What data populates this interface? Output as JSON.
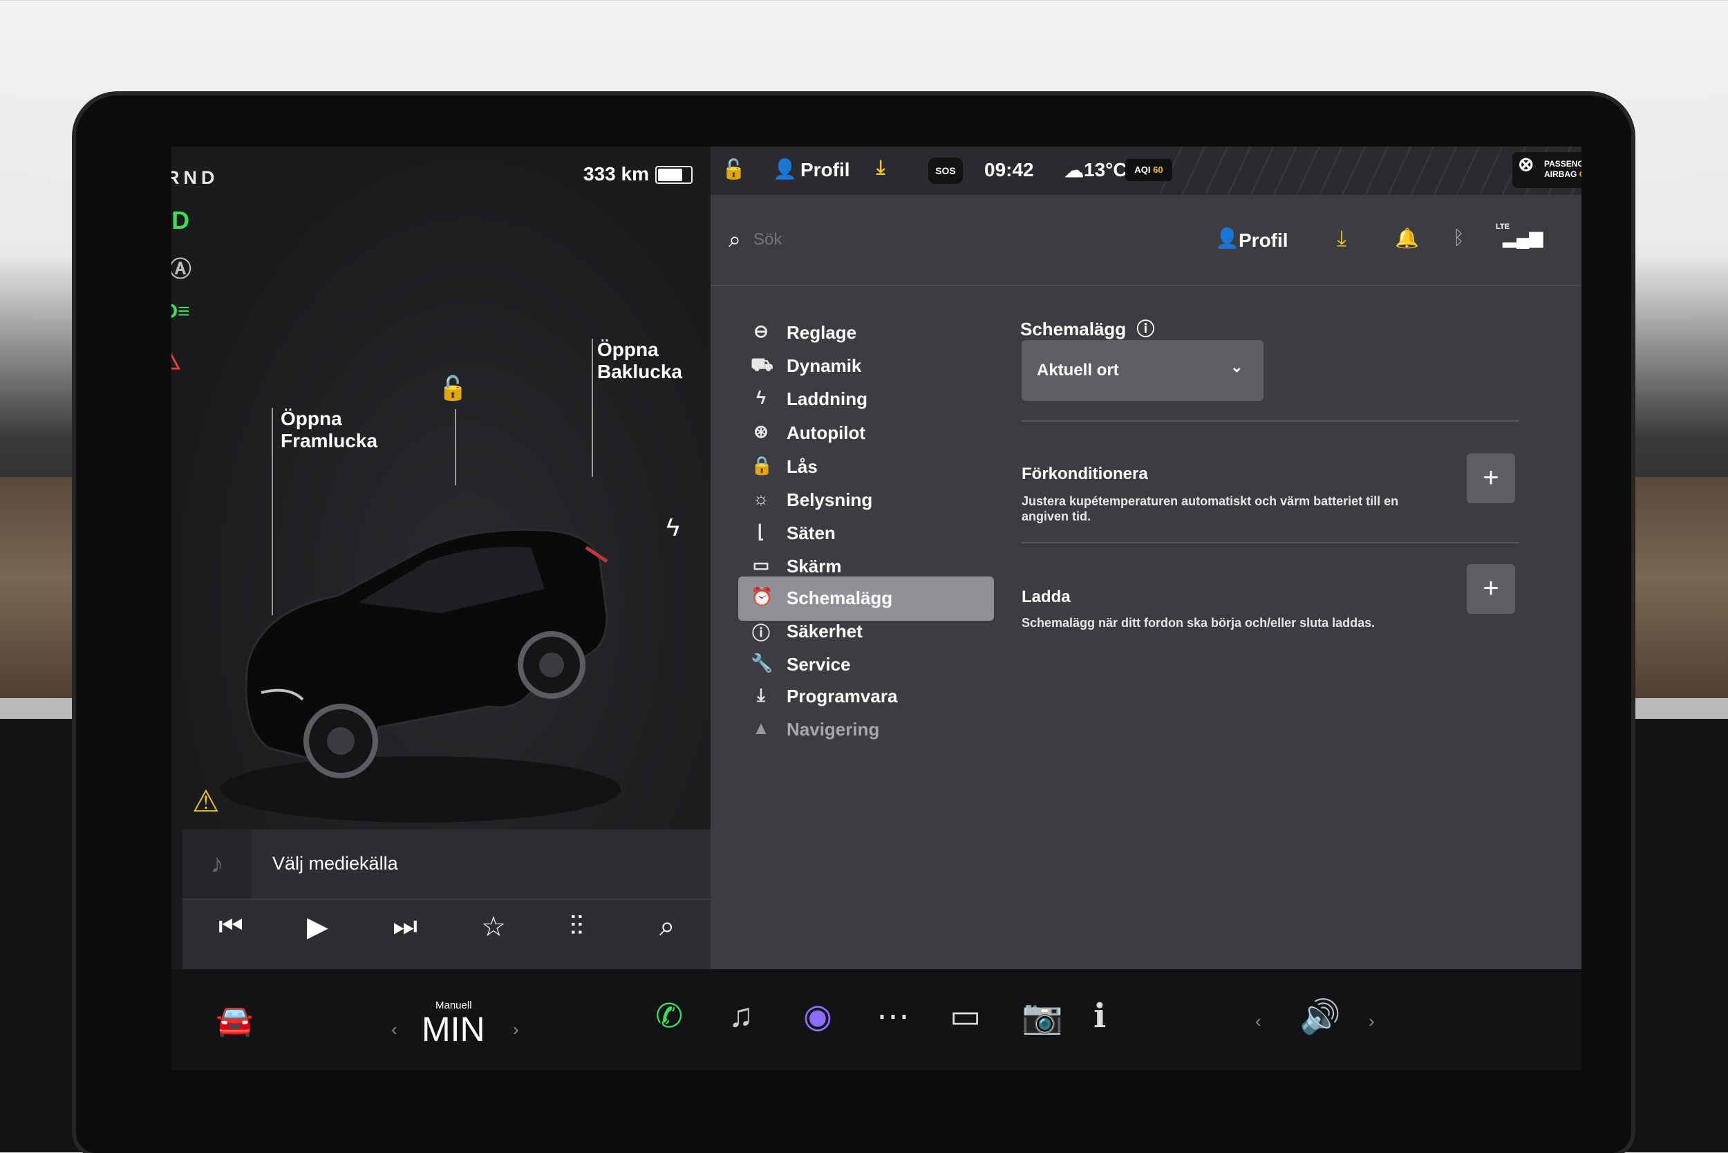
{
  "status": {
    "gear": "PRND",
    "range": "333 km",
    "battery_level": 0.7,
    "time": "09:42",
    "temperature": "13°C",
    "aqi_label": "AQI",
    "aqi_value": "60",
    "profile": "Profil",
    "sos": "SOS",
    "airbag_line1": "PASSENGER",
    "airbag_line2": "AIRBAG",
    "airbag_state": "ON",
    "lte": "LTE"
  },
  "car": {
    "frunk_label_1": "Öppna",
    "frunk_label_2": "Framlucka",
    "trunk_label_1": "Öppna",
    "trunk_label_2": "Baklucka"
  },
  "media": {
    "source_label": "Välj mediekälla"
  },
  "dock": {
    "climate_label": "Manuell",
    "climate_value": "MIN"
  },
  "search": {
    "placeholder": "Sök",
    "profile_label": "Profil"
  },
  "nav": {
    "items": [
      {
        "label": "Reglage"
      },
      {
        "label": "Dynamik"
      },
      {
        "label": "Laddning"
      },
      {
        "label": "Autopilot"
      },
      {
        "label": "Lås"
      },
      {
        "label": "Belysning"
      },
      {
        "label": "Säten"
      },
      {
        "label": "Skärm"
      },
      {
        "label": "Schemalägg"
      },
      {
        "label": "Säkerhet"
      },
      {
        "label": "Service"
      },
      {
        "label": "Programvara"
      },
      {
        "label": "Navigering"
      }
    ],
    "active": "Schemalägg"
  },
  "panel": {
    "title": "Schemalägg",
    "location_select": "Aktuell ort",
    "options": [
      {
        "title": "Förkonditionera",
        "description": "Justera kupétemperaturen automatiskt och värm batteriet till en angiven tid."
      },
      {
        "title": "Ladda",
        "description": "Schemalägg när ditt fordon ska börja och/eller sluta laddas."
      }
    ]
  },
  "colors": {
    "indicator_green": "#3ddc5a",
    "seatbelt_red": "#e0413c",
    "warning_yellow": "#f3c026",
    "download_yellow": "#f3c026",
    "active_nav": "#8f9196"
  }
}
